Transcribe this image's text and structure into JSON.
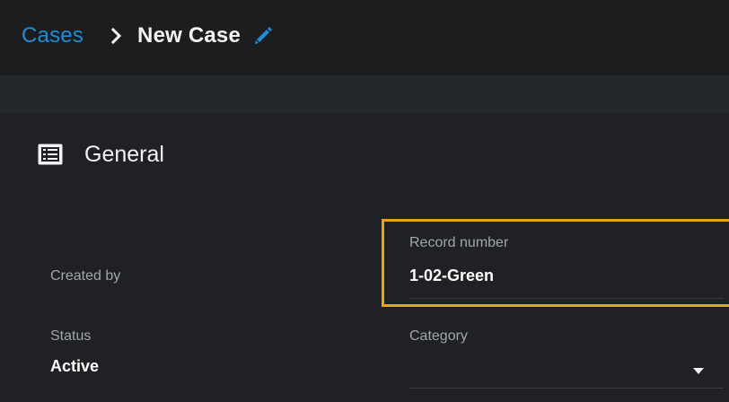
{
  "breadcrumb": {
    "parent": "Cases",
    "current": "New Case",
    "separator_icon": "chevron-right-icon",
    "edit_icon": "pencil-icon"
  },
  "section": {
    "title": "General",
    "icon": "list-form-icon"
  },
  "fields": {
    "created_by": {
      "label": "Created by",
      "value": ""
    },
    "record_number": {
      "label": "Record number",
      "value": "1-02-Green"
    },
    "status": {
      "label": "Status",
      "value": "Active"
    },
    "category": {
      "label": "Category",
      "value": ""
    }
  },
  "colors": {
    "background": "#1f2124",
    "header": "#1b1d1f",
    "link": "#1e8fd6",
    "highlight": "#f0a20f",
    "label": "#a2a6aa",
    "text": "#f2f3f4"
  }
}
